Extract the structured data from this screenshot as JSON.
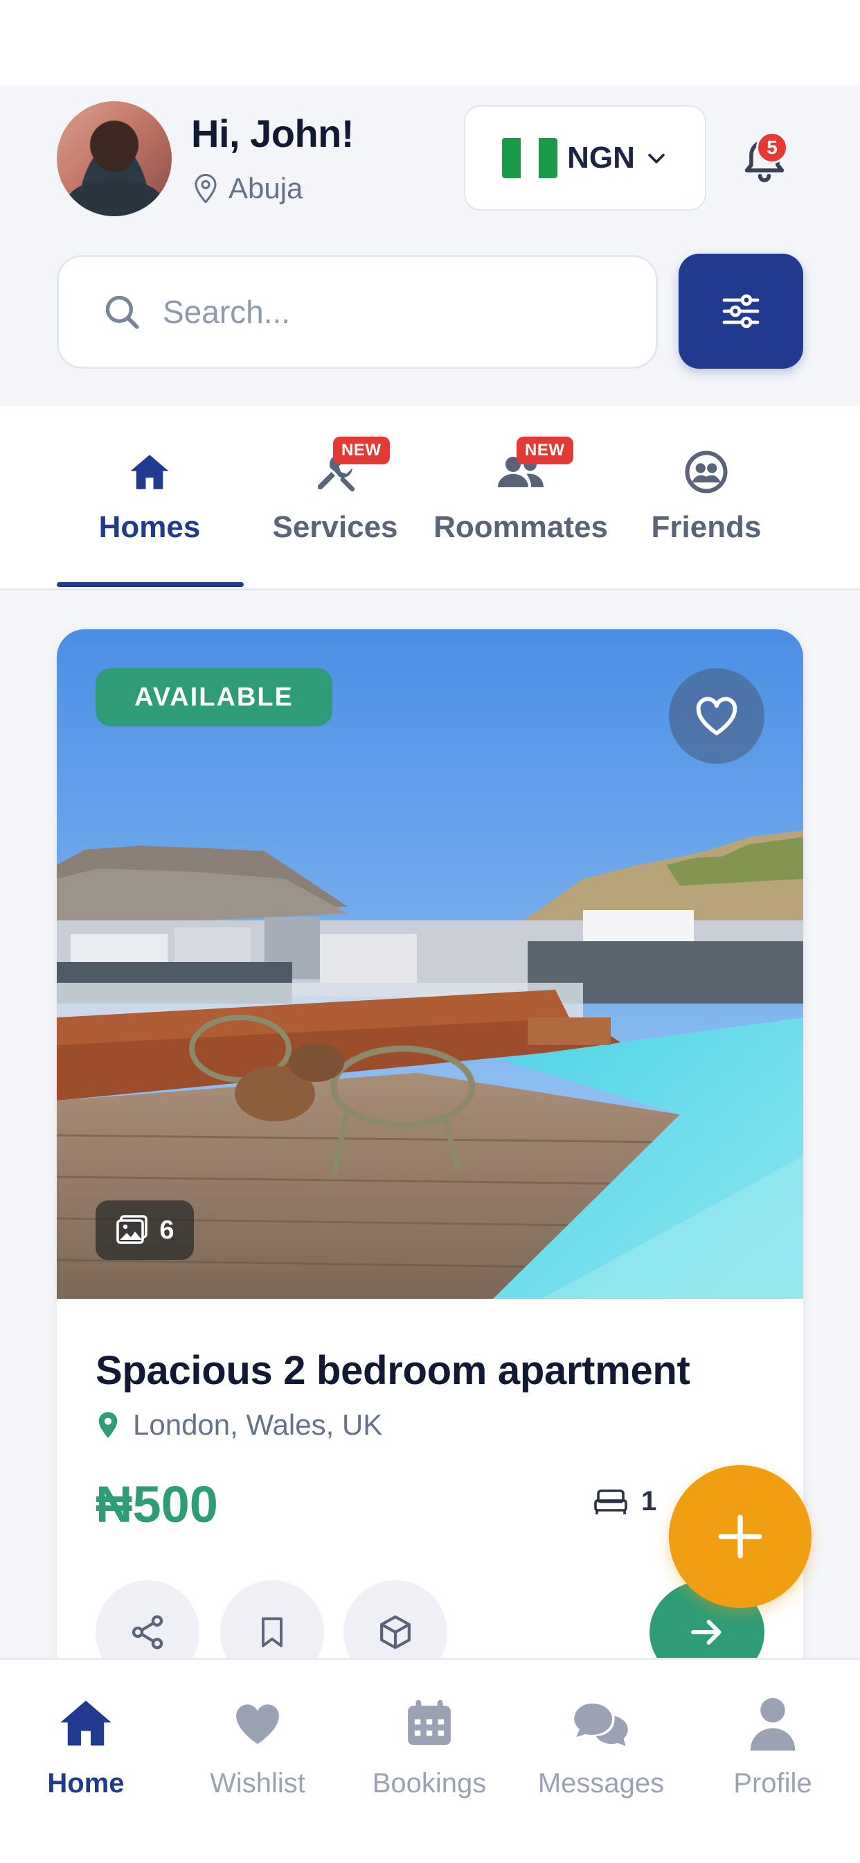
{
  "header": {
    "greeting": "Hi, John!",
    "location": "Abuja",
    "currency": "NGN",
    "notification_count": "5",
    "icons": {
      "location": "map-pin-icon",
      "currency": "chevron-down-icon",
      "notifications": "bell-icon"
    }
  },
  "search": {
    "placeholder": "Search...",
    "icons": {
      "search": "search-icon",
      "filter": "sliders-icon"
    }
  },
  "tabs": [
    {
      "label": "Homes",
      "icon": "house-icon",
      "active": true
    },
    {
      "label": "Services",
      "icon": "tools-icon",
      "badge": "NEW"
    },
    {
      "label": "Roommates",
      "icon": "users-icon",
      "badge": "NEW"
    },
    {
      "label": "Friends",
      "icon": "friends-icon"
    }
  ],
  "listing": {
    "status": "AVAILABLE",
    "photo_count": "6",
    "title": "Spacious 2 bedroom apartment",
    "location": "London, Wales, UK",
    "price": "₦500",
    "beds": "1",
    "icons": [
      "heart-icon",
      "gallery-icon",
      "map-pin-icon",
      "bed-icon",
      "share-icon",
      "bookmark-icon",
      "cube-icon",
      "arrow-right-icon"
    ]
  },
  "fab": {
    "icon": "plus-icon"
  },
  "bottom_nav": [
    {
      "label": "Home",
      "icon": "home-icon",
      "active": true
    },
    {
      "label": "Wishlist",
      "icon": "heart-icon"
    },
    {
      "label": "Bookings",
      "icon": "calendar-icon"
    },
    {
      "label": "Messages",
      "icon": "chat-icon"
    },
    {
      "label": "Profile",
      "icon": "user-icon"
    }
  ],
  "colors": {
    "primary": "#1f3a8f",
    "accent_green": "#2e9c76",
    "accent_orange": "#f29e13",
    "badge_red": "#e53935"
  }
}
